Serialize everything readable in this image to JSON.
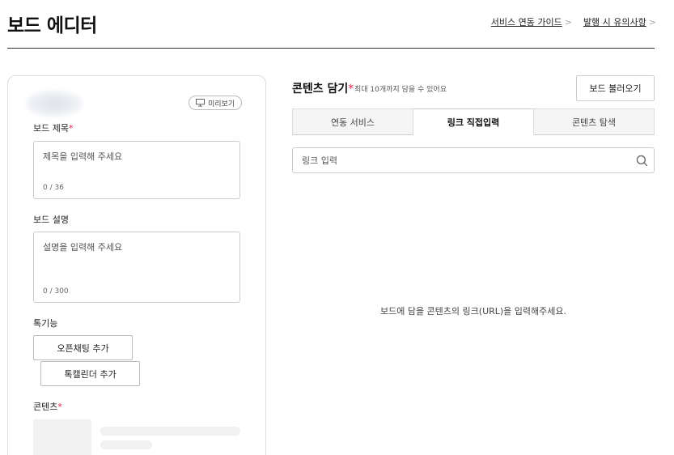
{
  "header": {
    "title": "보드 에디터",
    "links": [
      {
        "label": "서비스 연동 가이드",
        "chevron": ">"
      },
      {
        "label": "발행 시 유의사항",
        "chevron": ">"
      }
    ]
  },
  "left": {
    "preview_label": "미리보기",
    "title_field": {
      "label": "보드 제목",
      "required": "*",
      "placeholder": "제목을 입력해 주세요",
      "count": "0 / 36"
    },
    "desc_field": {
      "label": "보드 설명",
      "placeholder": "설명을 입력해 주세요",
      "count": "0 / 300"
    },
    "features": {
      "label": "톡기능",
      "open_chat_btn": "오픈채팅 추가",
      "calendar_btn": "톡캘린더 추가"
    },
    "contents": {
      "label": "콘텐츠",
      "required": "*"
    }
  },
  "right": {
    "title": "콘텐츠 담기",
    "required": "*",
    "hint": "최대 10개까지 담을 수 있어요",
    "load_btn": "보드 불러오기",
    "tabs": [
      {
        "label": "연동 서비스",
        "active": false
      },
      {
        "label": "링크 직접입력",
        "active": true
      },
      {
        "label": "콘텐츠 탐색",
        "active": false
      }
    ],
    "link_input": {
      "placeholder": "링크 입력",
      "value": ""
    },
    "empty_message": "보드에 담을 콘텐츠의 링크(URL)을 입력해주세요."
  },
  "colors": {
    "required": "#e0224b",
    "border": "#cccccc",
    "tab_inactive_bg": "#f5f5f5"
  }
}
